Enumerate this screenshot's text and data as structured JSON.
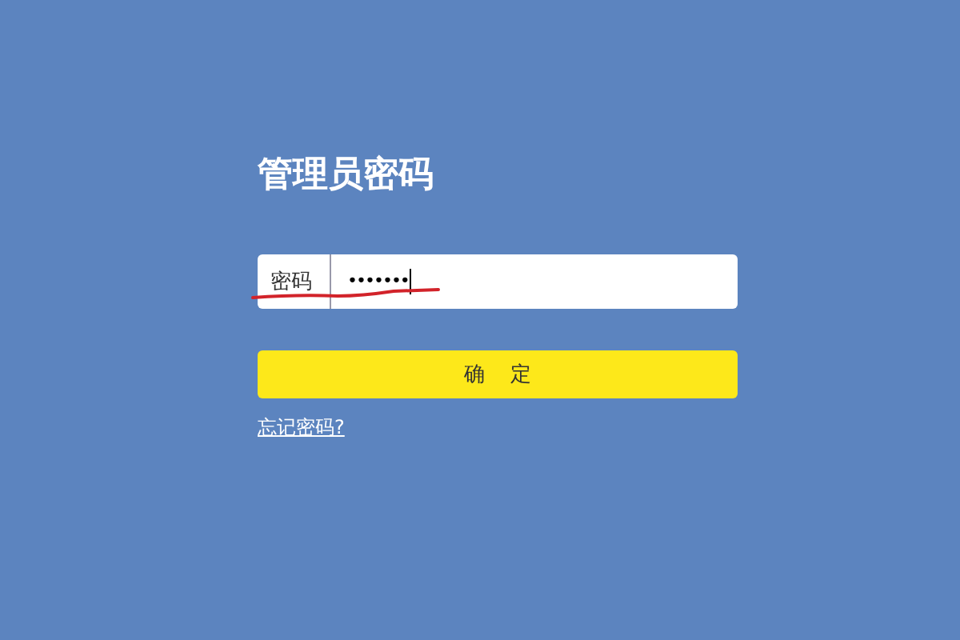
{
  "title": "管理员密码",
  "password_field": {
    "label": "密码",
    "value": "•••••••"
  },
  "confirm_button": "确 定",
  "forgot_link": "忘记密码?"
}
